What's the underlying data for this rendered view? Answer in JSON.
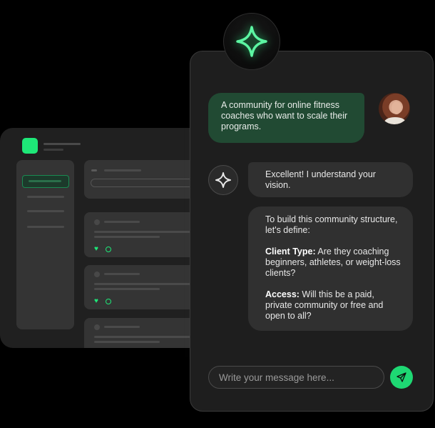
{
  "colors": {
    "accent": "#1ee878",
    "user_bubble": "#214a33",
    "bot_bubble": "#303030",
    "panel": "#1e1e1e",
    "background": "#000000"
  },
  "icons": {
    "badge": "sparkle-star-icon",
    "bot": "sparkle-star-icon",
    "send": "paper-plane-icon",
    "like": "heart-icon",
    "comment": "comment-icon"
  },
  "chat": {
    "messages": [
      {
        "role": "user",
        "text": "A community for online fitness coaches who want to scale their programs."
      },
      {
        "role": "bot",
        "text": "Excellent! I understand your vision."
      },
      {
        "role": "bot",
        "intro": "To build this community structure, let's define:",
        "points": [
          {
            "label": "Client Type:",
            "text": " Are they coaching beginners, athletes, or weight-loss clients?"
          },
          {
            "label": "Access:",
            "text": " Will this be a paid, private community or free and open to all?"
          }
        ]
      }
    ],
    "input": {
      "placeholder": "Write your message here...",
      "value": ""
    }
  }
}
